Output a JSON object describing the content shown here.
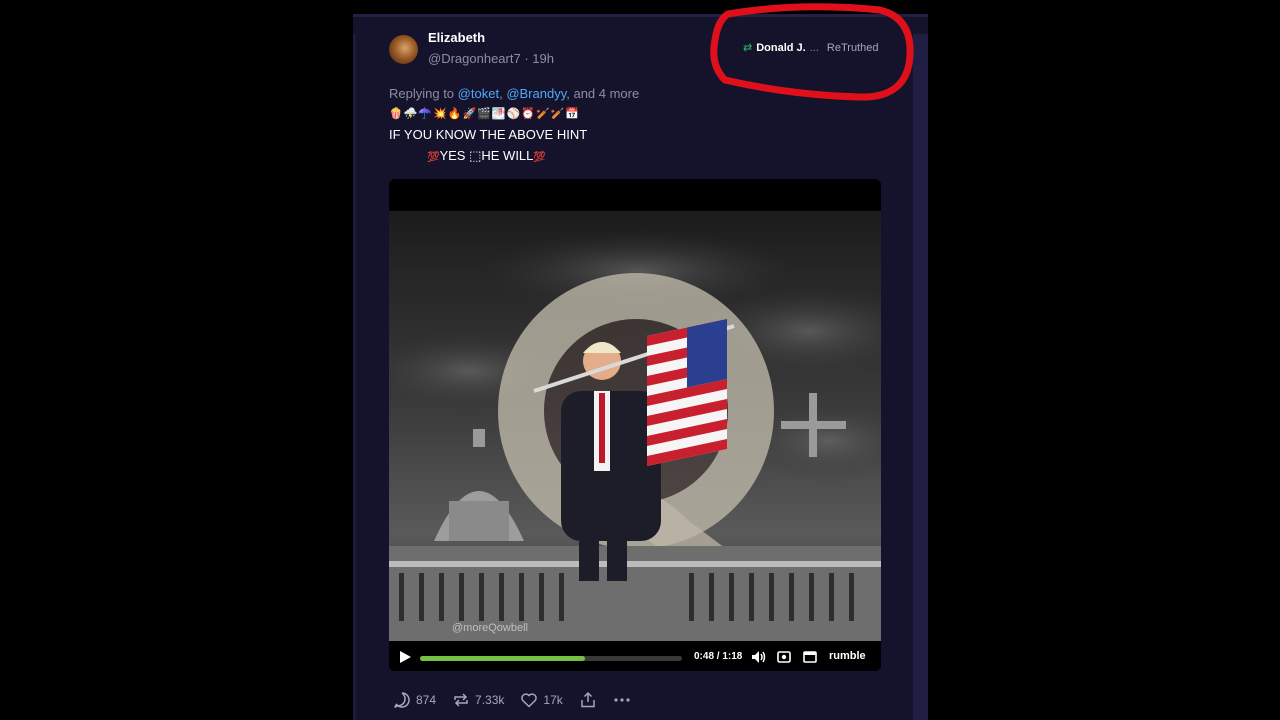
{
  "post": {
    "author_name": "Elizabeth",
    "author_handle": "@Dragonheart7",
    "separator": "·",
    "timestamp": "19h",
    "retruth": {
      "icon": "retruth-icon",
      "name": "Donald J.",
      "ellipsis": "...",
      "label": "ReTruthed"
    },
    "replying": {
      "prefix": "Replying to",
      "mention_1": "@toket",
      "comma": ",",
      "mention_2": "@Brandyy",
      "suffix": ", and 4 more"
    },
    "emoji_line": "🍿⛈️☂️💥🔥🚀🎬🌁⚾⏰🏏🏏📅",
    "line_1": "IF YOU KNOW THE ABOVE HINT",
    "line_2": {
      "emoji_left": "💯",
      "text": "YES ",
      "placeholder_glyph": "⬚",
      "text_2": "HE WILL",
      "emoji_right": "💯"
    }
  },
  "video": {
    "watermark": "@moreQowbell",
    "progress_fraction": 0.63,
    "time": "0:48 / 1:18",
    "brand": "rumble",
    "icons": [
      "play-icon",
      "volume-icon",
      "settings-icon",
      "pip-icon"
    ]
  },
  "actions": {
    "replies": "874",
    "retruths": "7.33k",
    "likes": "17k",
    "icons": [
      "reply-icon",
      "retruth-icon",
      "like-icon",
      "share-icon",
      "more-icon"
    ]
  },
  "colors": {
    "card_bg": "#15132c",
    "mention": "#4fa8f7",
    "retruth_green": "#2bb673",
    "progress_green": "#75c045",
    "annotation_red": "#e0101a"
  }
}
